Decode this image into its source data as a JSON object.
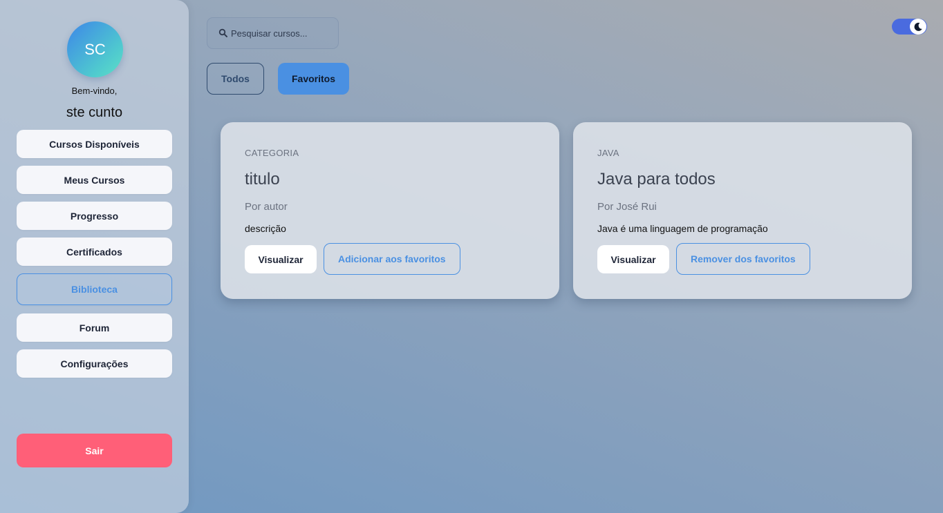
{
  "sidebar": {
    "avatar_initials": "SC",
    "welcome": "Bem-vindo,",
    "username": "ste cunto",
    "items": [
      {
        "label": "Cursos Disponíveis"
      },
      {
        "label": "Meus Cursos"
      },
      {
        "label": "Progresso"
      },
      {
        "label": "Certificados"
      },
      {
        "label": "Biblioteca",
        "active": true
      },
      {
        "label": "Forum"
      },
      {
        "label": "Configurações"
      }
    ],
    "logout_label": "Sair"
  },
  "search": {
    "placeholder": "Pesquisar cursos...",
    "icon": "search-icon"
  },
  "theme_toggle": {
    "icon": "moon-icon",
    "state": "dark"
  },
  "tabs": [
    {
      "label": "Todos",
      "active": false
    },
    {
      "label": "Favoritos",
      "active": true
    }
  ],
  "cards": [
    {
      "category": "CATEGORIA",
      "title": "titulo",
      "author": "Por autor",
      "description": "descrição",
      "view_label": "Visualizar",
      "favorite_label": "Adicionar aos favoritos"
    },
    {
      "category": "JAVA",
      "title": "Java para todos",
      "author": "Por José Rui",
      "description": "Java é uma linguagem de programação",
      "view_label": "Visualizar",
      "favorite_label": "Remover dos favoritos"
    }
  ],
  "colors": {
    "accent": "#4a90e2",
    "logout": "#ff5f78",
    "toggle": "#4a6bdf"
  }
}
